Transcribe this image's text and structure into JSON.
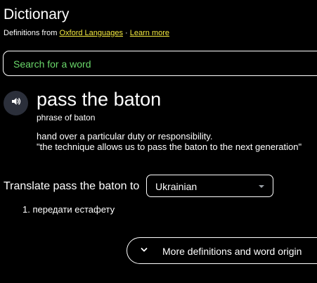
{
  "header": {
    "title": "Dictionary",
    "source_prefix": "Definitions from ",
    "source_link": "Oxford Languages",
    "separator": " · ",
    "learn_more": "Learn more"
  },
  "search": {
    "placeholder": "Search for a word"
  },
  "entry": {
    "headword": "pass the baton",
    "phrase_of": "phrase of baton",
    "definition": "hand over a particular duty or responsibility.",
    "example": "\"the technique allows us to pass the baton to the next generation\"",
    "audio_icon": "speaker-icon"
  },
  "translate": {
    "label": "Translate pass the baton to",
    "selected_language": "Ukrainian",
    "results": [
      "1. передати естафету"
    ]
  },
  "more": {
    "label": "More definitions and word origin",
    "icon": "chevron-down-icon"
  },
  "colors": {
    "link": "#f4ea3f",
    "placeholder": "#6ad86a",
    "audio_button_bg": "#2b2f3a"
  }
}
